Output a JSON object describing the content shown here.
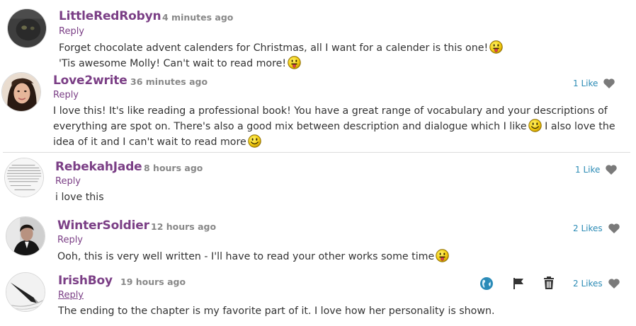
{
  "colors": {
    "username": "#7b3f86",
    "likes": "#2b8bb5",
    "heart": "#777777",
    "time": "#888888"
  },
  "comments": [
    {
      "username": "LittleRedRobyn",
      "time": "4 minutes ago",
      "reply": "Reply",
      "body_line1": "Forget chocolate advent calenders for Christmas, all I want for a calender is this one!",
      "body_line2": "'Tis awesome Molly! Can't wait to read more!",
      "avatar_icon": "black-cat-avatar",
      "emoticons": [
        "tongue-smiley-icon",
        "tongue-smiley-icon"
      ]
    },
    {
      "username": "Love2write",
      "time": "36 minutes ago",
      "reply": "Reply",
      "likes": "1 Like",
      "body_line1": "I love this! It's like reading a professional book! You have a great range of vocabulary and your descriptions of",
      "body_line2a": "everything are spot on. There's also a good mix between description and dialogue which I like",
      "body_line2b": "I also love the",
      "body_line3": "idea of it and I can't wait to read more",
      "avatar_icon": "portrait-avatar",
      "emoticons": [
        "smile-icon",
        "smile-icon"
      ]
    },
    {
      "username": "RebekahJade",
      "time": "8 hours ago",
      "reply": "Reply",
      "likes": "1 Like",
      "body_line1": "i love this",
      "avatar_icon": "text-quote-avatar"
    },
    {
      "username": "WinterSoldier",
      "time": "12 hours ago",
      "reply": "Reply",
      "likes": "2 Likes",
      "body_line1": "Ooh, this is very well written - I'll have to read your other works some time",
      "avatar_icon": "man-in-suit-avatar",
      "emoticons": [
        "tongue-smiley-icon"
      ]
    },
    {
      "username": "IrishBoy",
      "time": "19 hours ago",
      "reply": "Reply",
      "likes": "2 Likes",
      "body_line1": "The ending to the chapter is my favorite part of it. I love how her personality is shown.",
      "avatar_icon": "fountain-pen-avatar",
      "tools": [
        "globe-icon",
        "flag-icon",
        "trash-icon"
      ]
    }
  ]
}
